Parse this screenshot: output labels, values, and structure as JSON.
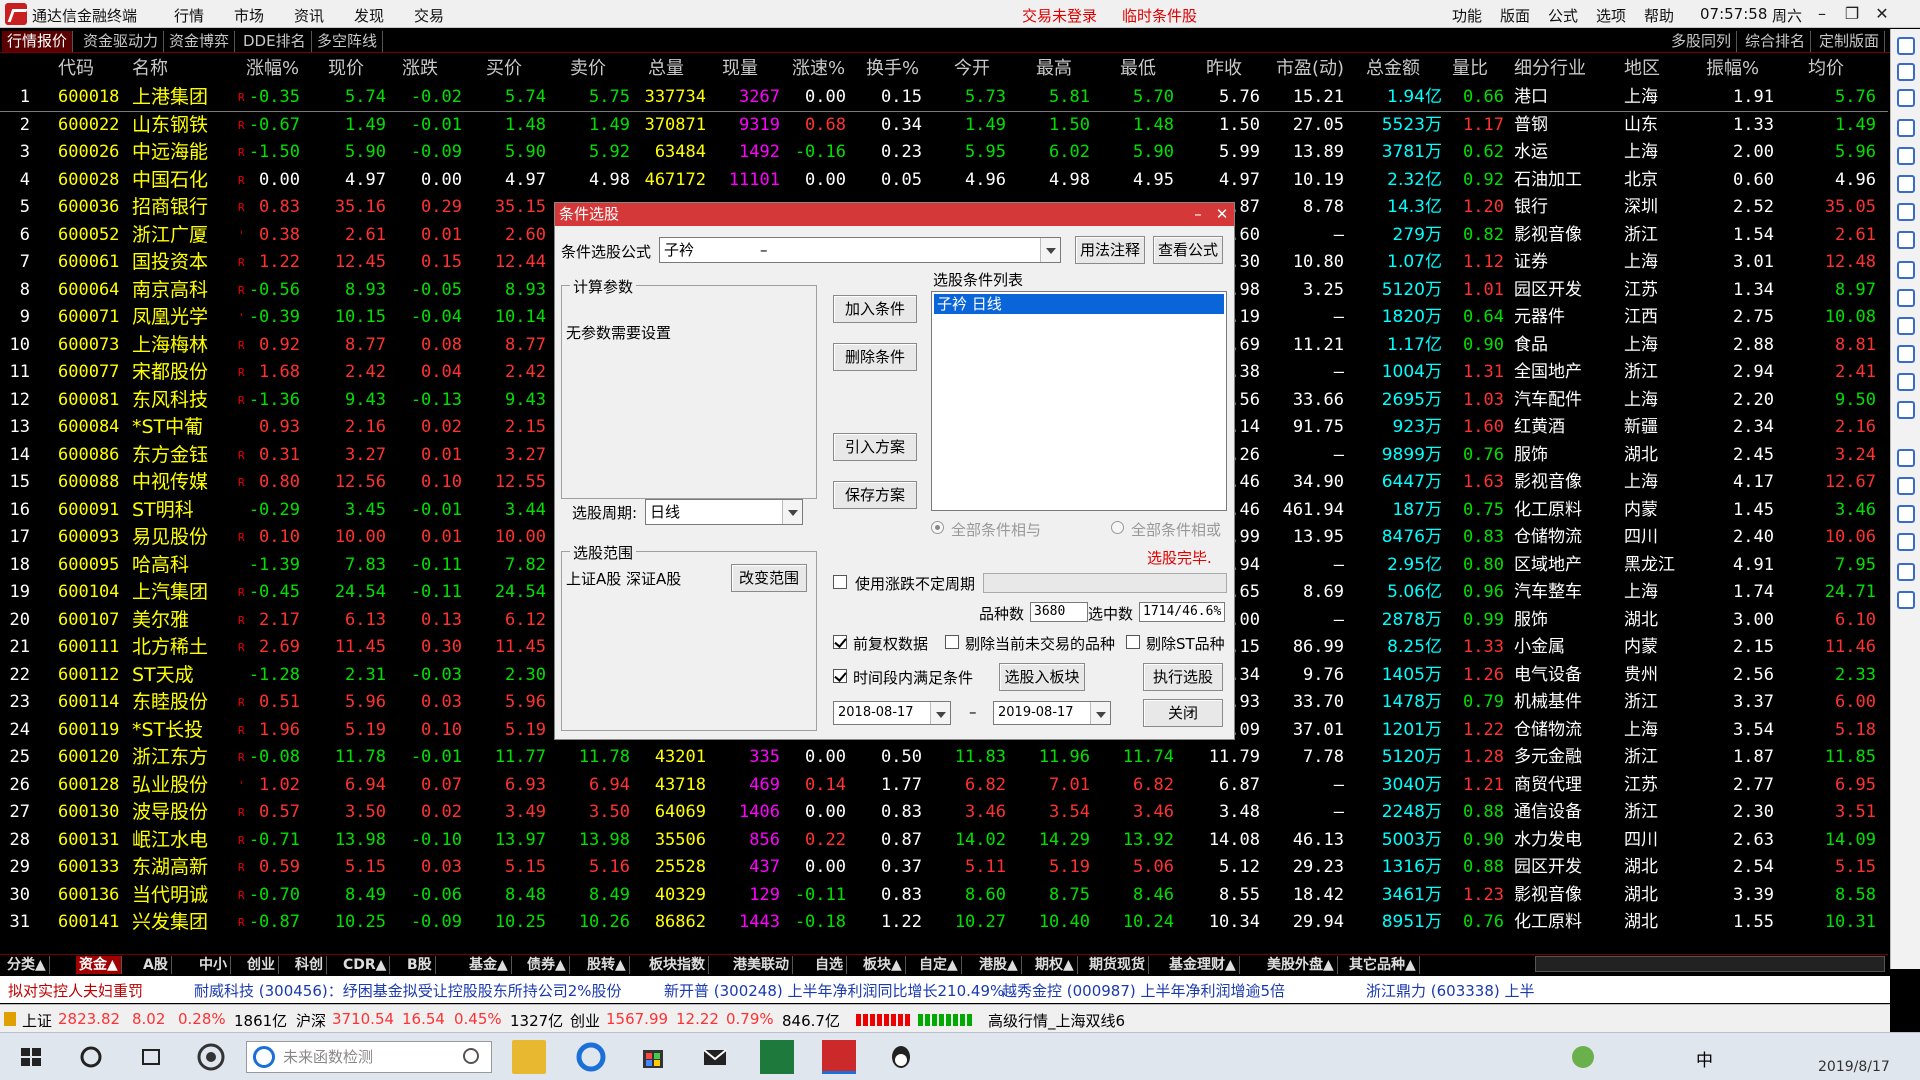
{
  "titlebar": {
    "app_title": "通达信金融终端",
    "menu": [
      "行情",
      "市场",
      "资讯",
      "发现",
      "交易"
    ],
    "status_not_logged": "交易未登录",
    "status_condition": "临时条件股",
    "right_menu": [
      "功能",
      "版面",
      "公式",
      "选项",
      "帮助"
    ],
    "clock": "07:57:58",
    "weekday": "周六"
  },
  "tabs": {
    "left": [
      "行情报价",
      "资金驱动力",
      "资金博弈",
      "DDE排名",
      "多空阵线"
    ],
    "right": [
      "多股同列",
      "综合排名",
      "定制版面"
    ]
  },
  "columns": [
    "代码",
    "名称",
    "涨幅%",
    "现价",
    "涨跌",
    "买价",
    "卖价",
    "总量",
    "现量",
    "涨速%",
    "换手%",
    "今开",
    "最高",
    "最低",
    "昨收",
    "市盈(动)",
    "总金额",
    "量比",
    "细分行业",
    "地区",
    "振幅%",
    "均价"
  ],
  "rows": [
    {
      "idx": "1",
      "code": "600018",
      "name": "上港集团",
      "r": "R",
      "pct": "-0.35",
      "price": "5.74",
      "chg": "-0.02",
      "bid": "5.74",
      "ask": "5.75",
      "vol": "337734",
      "cur": "3267",
      "speed": "0.00",
      "turn": "0.15",
      "open": "5.73",
      "high": "5.81",
      "low": "5.70",
      "prev": "5.76",
      "pe": "15.21",
      "amt": "1.94亿",
      "vr": "0.66",
      "ind": "港口",
      "area": "上海",
      "amp": "1.91",
      "avg": "5.76"
    },
    {
      "idx": "2",
      "code": "600022",
      "name": "山东钢铁",
      "r": "R",
      "pct": "-0.67",
      "price": "1.49",
      "chg": "-0.01",
      "bid": "1.48",
      "ask": "1.49",
      "vol": "370871",
      "cur": "9319",
      "speed": "0.68",
      "turn": "0.34",
      "open": "1.49",
      "high": "1.50",
      "low": "1.48",
      "prev": "1.50",
      "pe": "27.05",
      "amt": "5523万",
      "vr": "1.17",
      "ind": "普钢",
      "area": "山东",
      "amp": "1.33",
      "avg": "1.49"
    },
    {
      "idx": "3",
      "code": "600026",
      "name": "中远海能",
      "r": "R",
      "pct": "-1.50",
      "price": "5.90",
      "chg": "-0.09",
      "bid": "5.90",
      "ask": "5.92",
      "vol": "63484",
      "cur": "1492",
      "speed": "-0.16",
      "turn": "0.23",
      "open": "5.95",
      "high": "6.02",
      "low": "5.90",
      "prev": "5.99",
      "pe": "13.89",
      "amt": "3781万",
      "vr": "0.62",
      "ind": "水运",
      "area": "上海",
      "amp": "2.00",
      "avg": "5.96"
    },
    {
      "idx": "4",
      "code": "600028",
      "name": "中国石化",
      "r": "R",
      "pct": "0.00",
      "price": "4.97",
      "chg": "0.00",
      "bid": "4.97",
      "ask": "4.98",
      "vol": "467172",
      "cur": "11101",
      "speed": "0.00",
      "turn": "0.05",
      "open": "4.96",
      "high": "4.98",
      "low": "4.95",
      "prev": "4.97",
      "pe": "10.19",
      "amt": "2.32亿",
      "vr": "0.92",
      "ind": "石油加工",
      "area": "北京",
      "amp": "0.60",
      "avg": "4.96"
    },
    {
      "idx": "5",
      "code": "600036",
      "name": "招商银行",
      "r": "R",
      "pct": "0.83",
      "price": "35.16",
      "chg": "0.29",
      "bid": "35.15",
      "ask": "",
      "vol": "",
      "cur": "",
      "speed": "",
      "turn": "",
      "open": "",
      "high": "",
      "low": "",
      "prev": ".87",
      "pe": "8.78",
      "amt": "14.3亿",
      "vr": "1.20",
      "ind": "银行",
      "area": "深圳",
      "amp": "2.52",
      "avg": "35.05"
    },
    {
      "idx": "6",
      "code": "600052",
      "name": "浙江广厦",
      "r": "'",
      "pct": "0.38",
      "price": "2.61",
      "chg": "0.01",
      "bid": "2.60",
      "ask": "",
      "vol": "",
      "cur": "",
      "speed": "",
      "turn": "",
      "open": "",
      "high": "",
      "low": "",
      "prev": ".60",
      "pe": "—",
      "amt": "279万",
      "vr": "0.82",
      "ind": "影视音像",
      "area": "浙江",
      "amp": "1.54",
      "avg": "2.61"
    },
    {
      "idx": "7",
      "code": "600061",
      "name": "国投资本",
      "r": "R",
      "pct": "1.22",
      "price": "12.45",
      "chg": "0.15",
      "bid": "12.44",
      "ask": "",
      "vol": "",
      "cur": "",
      "speed": "",
      "turn": "",
      "open": "",
      "high": "",
      "low": "",
      "prev": ".30",
      "pe": "10.80",
      "amt": "1.07亿",
      "vr": "1.12",
      "ind": "证券",
      "area": "上海",
      "amp": "3.01",
      "avg": "12.48"
    },
    {
      "idx": "8",
      "code": "600064",
      "name": "南京高科",
      "r": "R",
      "pct": "-0.56",
      "price": "8.93",
      "chg": "-0.05",
      "bid": "8.93",
      "ask": "",
      "vol": "",
      "cur": "",
      "speed": "",
      "turn": "",
      "open": "",
      "high": "",
      "low": "",
      "prev": ".98",
      "pe": "3.25",
      "amt": "5120万",
      "vr": "1.01",
      "ind": "园区开发",
      "area": "江苏",
      "amp": "1.34",
      "avg": "8.97"
    },
    {
      "idx": "9",
      "code": "600071",
      "name": "凤凰光学",
      "r": "'",
      "pct": "-0.39",
      "price": "10.15",
      "chg": "-0.04",
      "bid": "10.14",
      "ask": "",
      "vol": "",
      "cur": "",
      "speed": "",
      "turn": "",
      "open": "",
      "high": "",
      "low": "",
      "prev": ".19",
      "pe": "—",
      "amt": "1820万",
      "vr": "0.64",
      "ind": "元器件",
      "area": "江西",
      "amp": "2.75",
      "avg": "10.08"
    },
    {
      "idx": "10",
      "code": "600073",
      "name": "上海梅林",
      "r": "R",
      "pct": "0.92",
      "price": "8.77",
      "chg": "0.08",
      "bid": "8.77",
      "ask": "",
      "vol": "",
      "cur": "",
      "speed": "",
      "turn": "",
      "open": "",
      "high": "",
      "low": "",
      "prev": ".69",
      "pe": "11.21",
      "amt": "1.17亿",
      "vr": "0.90",
      "ind": "食品",
      "area": "上海",
      "amp": "2.88",
      "avg": "8.81"
    },
    {
      "idx": "11",
      "code": "600077",
      "name": "宋都股份",
      "r": "R",
      "pct": "1.68",
      "price": "2.42",
      "chg": "0.04",
      "bid": "2.42",
      "ask": "",
      "vol": "",
      "cur": "",
      "speed": "",
      "turn": "",
      "open": "",
      "high": "",
      "low": "",
      "prev": ".38",
      "pe": "—",
      "amt": "1004万",
      "vr": "1.31",
      "ind": "全国地产",
      "area": "浙江",
      "amp": "2.94",
      "avg": "2.41"
    },
    {
      "idx": "12",
      "code": "600081",
      "name": "东风科技",
      "r": "R",
      "pct": "-1.36",
      "price": "9.43",
      "chg": "-0.13",
      "bid": "9.43",
      "ask": "",
      "vol": "",
      "cur": "",
      "speed": "",
      "turn": "",
      "open": "",
      "high": "",
      "low": "",
      "prev": ".56",
      "pe": "33.66",
      "amt": "2695万",
      "vr": "1.03",
      "ind": "汽车配件",
      "area": "上海",
      "amp": "2.20",
      "avg": "9.50"
    },
    {
      "idx": "13",
      "code": "600084",
      "name": "*ST中葡",
      "r": "",
      "pct": "0.93",
      "price": "2.16",
      "chg": "0.02",
      "bid": "2.15",
      "ask": "",
      "vol": "",
      "cur": "",
      "speed": "",
      "turn": "",
      "open": "",
      "high": "",
      "low": "",
      "prev": ".14",
      "pe": "91.75",
      "amt": "923万",
      "vr": "1.60",
      "ind": "红黄酒",
      "area": "新疆",
      "amp": "2.34",
      "avg": "2.16"
    },
    {
      "idx": "14",
      "code": "600086",
      "name": "东方金钰",
      "r": "R",
      "pct": "0.31",
      "price": "3.27",
      "chg": "0.01",
      "bid": "3.27",
      "ask": "",
      "vol": "",
      "cur": "",
      "speed": "",
      "turn": "",
      "open": "",
      "high": "",
      "low": "",
      "prev": ".26",
      "pe": "—",
      "amt": "9899万",
      "vr": "0.76",
      "ind": "服饰",
      "area": "湖北",
      "amp": "2.45",
      "avg": "3.24"
    },
    {
      "idx": "15",
      "code": "600088",
      "name": "中视传媒",
      "r": "R",
      "pct": "0.80",
      "price": "12.56",
      "chg": "0.10",
      "bid": "12.55",
      "ask": "",
      "vol": "",
      "cur": "",
      "speed": "",
      "turn": "",
      "open": "",
      "high": "",
      "low": "",
      "prev": ".46",
      "pe": "34.90",
      "amt": "6447万",
      "vr": "1.63",
      "ind": "影视音像",
      "area": "上海",
      "amp": "4.17",
      "avg": "12.67"
    },
    {
      "idx": "16",
      "code": "600091",
      "name": "ST明科",
      "r": "",
      "pct": "-0.29",
      "price": "3.45",
      "chg": "-0.01",
      "bid": "3.44",
      "ask": "",
      "vol": "",
      "cur": "",
      "speed": "",
      "turn": "",
      "open": "",
      "high": "",
      "low": "",
      "prev": ".46",
      "pe": "461.94",
      "amt": "187万",
      "vr": "0.75",
      "ind": "化工原料",
      "area": "内蒙",
      "amp": "1.45",
      "avg": "3.46"
    },
    {
      "idx": "17",
      "code": "600093",
      "name": "易见股份",
      "r": "R",
      "pct": "0.10",
      "price": "10.00",
      "chg": "0.01",
      "bid": "10.00",
      "ask": "",
      "vol": "",
      "cur": "",
      "speed": "",
      "turn": "",
      "open": "",
      "high": "",
      "low": "",
      "prev": ".99",
      "pe": "13.95",
      "amt": "8476万",
      "vr": "0.83",
      "ind": "仓储物流",
      "area": "四川",
      "amp": "2.40",
      "avg": "10.06"
    },
    {
      "idx": "18",
      "code": "600095",
      "name": "哈高科",
      "r": "",
      "pct": "-1.39",
      "price": "7.83",
      "chg": "-0.11",
      "bid": "7.82",
      "ask": "",
      "vol": "",
      "cur": "",
      "speed": "",
      "turn": "",
      "open": "",
      "high": "",
      "low": "",
      "prev": ".94",
      "pe": "—",
      "amt": "2.95亿",
      "vr": "0.80",
      "ind": "区域地产",
      "area": "黑龙江",
      "amp": "4.91",
      "avg": "7.95"
    },
    {
      "idx": "19",
      "code": "600104",
      "name": "上汽集团",
      "r": "R",
      "pct": "-0.45",
      "price": "24.54",
      "chg": "-0.11",
      "bid": "24.54",
      "ask": "",
      "vol": "",
      "cur": "",
      "speed": "",
      "turn": "",
      "open": "",
      "high": "",
      "low": "",
      "prev": ".65",
      "pe": "8.69",
      "amt": "5.06亿",
      "vr": "0.96",
      "ind": "汽车整车",
      "area": "上海",
      "amp": "1.74",
      "avg": "24.71"
    },
    {
      "idx": "20",
      "code": "600107",
      "name": "美尔雅",
      "r": "R",
      "pct": "2.17",
      "price": "6.13",
      "chg": "0.13",
      "bid": "6.12",
      "ask": "",
      "vol": "",
      "cur": "",
      "speed": "",
      "turn": "",
      "open": "",
      "high": "",
      "low": "",
      "prev": ".00",
      "pe": "—",
      "amt": "2878万",
      "vr": "0.99",
      "ind": "服饰",
      "area": "湖北",
      "amp": "3.00",
      "avg": "6.10"
    },
    {
      "idx": "21",
      "code": "600111",
      "name": "北方稀土",
      "r": "R",
      "pct": "2.69",
      "price": "11.45",
      "chg": "0.30",
      "bid": "11.45",
      "ask": "",
      "vol": "",
      "cur": "",
      "speed": "",
      "turn": "",
      "open": "",
      "high": "",
      "low": "",
      "prev": ".15",
      "pe": "86.99",
      "amt": "8.25亿",
      "vr": "1.33",
      "ind": "小金属",
      "area": "内蒙",
      "amp": "2.15",
      "avg": "11.46"
    },
    {
      "idx": "22",
      "code": "600112",
      "name": "ST天成",
      "r": "",
      "pct": "-1.28",
      "price": "2.31",
      "chg": "-0.03",
      "bid": "2.30",
      "ask": "",
      "vol": "",
      "cur": "",
      "speed": "",
      "turn": "",
      "open": "",
      "high": "",
      "low": "",
      "prev": ".34",
      "pe": "9.76",
      "amt": "1405万",
      "vr": "1.26",
      "ind": "电气设备",
      "area": "贵州",
      "amp": "2.56",
      "avg": "2.33"
    },
    {
      "idx": "23",
      "code": "600114",
      "name": "东睦股份",
      "r": "R",
      "pct": "0.51",
      "price": "5.96",
      "chg": "0.03",
      "bid": "5.96",
      "ask": "",
      "vol": "",
      "cur": "",
      "speed": "",
      "turn": "",
      "open": "",
      "high": "",
      "low": "",
      "prev": ".93",
      "pe": "33.70",
      "amt": "1478万",
      "vr": "0.79",
      "ind": "机械基件",
      "area": "浙江",
      "amp": "3.37",
      "avg": "6.00"
    },
    {
      "idx": "24",
      "code": "600119",
      "name": "*ST长投",
      "r": "R",
      "pct": "1.96",
      "price": "5.19",
      "chg": "0.10",
      "bid": "5.19",
      "ask": "",
      "vol": "",
      "cur": "",
      "speed": "",
      "turn": "",
      "open": "",
      "high": "",
      "low": "",
      "prev": ".09",
      "pe": "37.01",
      "amt": "1201万",
      "vr": "1.22",
      "ind": "仓储物流",
      "area": "上海",
      "amp": "3.54",
      "avg": "5.18"
    },
    {
      "idx": "25",
      "code": "600120",
      "name": "浙江东方",
      "r": "R",
      "pct": "-0.08",
      "price": "11.78",
      "chg": "-0.01",
      "bid": "11.77",
      "ask": "11.78",
      "vol": "43201",
      "cur": "335",
      "speed": "0.00",
      "turn": "0.50",
      "open": "11.83",
      "high": "11.96",
      "low": "11.74",
      "prev": "11.79",
      "pe": "7.78",
      "amt": "5120万",
      "vr": "1.28",
      "ind": "多元金融",
      "area": "浙江",
      "amp": "1.87",
      "avg": "11.85"
    },
    {
      "idx": "26",
      "code": "600128",
      "name": "弘业股份",
      "r": "'",
      "pct": "1.02",
      "price": "6.94",
      "chg": "0.07",
      "bid": "6.93",
      "ask": "6.94",
      "vol": "43718",
      "cur": "469",
      "speed": "0.14",
      "turn": "1.77",
      "open": "6.82",
      "high": "7.01",
      "low": "6.82",
      "prev": "6.87",
      "pe": "—",
      "amt": "3040万",
      "vr": "1.21",
      "ind": "商贸代理",
      "area": "江苏",
      "amp": "2.77",
      "avg": "6.95"
    },
    {
      "idx": "27",
      "code": "600130",
      "name": "波导股份",
      "r": "R",
      "pct": "0.57",
      "price": "3.50",
      "chg": "0.02",
      "bid": "3.49",
      "ask": "3.50",
      "vol": "64069",
      "cur": "1406",
      "speed": "0.00",
      "turn": "0.83",
      "open": "3.46",
      "high": "3.54",
      "low": "3.46",
      "prev": "3.48",
      "pe": "—",
      "amt": "2248万",
      "vr": "0.88",
      "ind": "通信设备",
      "area": "浙江",
      "amp": "2.30",
      "avg": "3.51"
    },
    {
      "idx": "28",
      "code": "600131",
      "name": "岷江水电",
      "r": "R",
      "pct": "-0.71",
      "price": "13.98",
      "chg": "-0.10",
      "bid": "13.97",
      "ask": "13.98",
      "vol": "35506",
      "cur": "856",
      "speed": "0.22",
      "turn": "0.87",
      "open": "14.02",
      "high": "14.29",
      "low": "13.92",
      "prev": "14.08",
      "pe": "46.13",
      "amt": "5003万",
      "vr": "0.90",
      "ind": "水力发电",
      "area": "四川",
      "amp": "2.63",
      "avg": "14.09"
    },
    {
      "idx": "29",
      "code": "600133",
      "name": "东湖高新",
      "r": "R",
      "pct": "0.59",
      "price": "5.15",
      "chg": "0.03",
      "bid": "5.15",
      "ask": "5.16",
      "vol": "25528",
      "cur": "437",
      "speed": "0.00",
      "turn": "0.37",
      "open": "5.11",
      "high": "5.19",
      "low": "5.06",
      "prev": "5.12",
      "pe": "29.23",
      "amt": "1316万",
      "vr": "0.88",
      "ind": "园区开发",
      "area": "湖北",
      "amp": "2.54",
      "avg": "5.15"
    },
    {
      "idx": "30",
      "code": "600136",
      "name": "当代明诚",
      "r": "R",
      "pct": "-0.70",
      "price": "8.49",
      "chg": "-0.06",
      "bid": "8.48",
      "ask": "8.49",
      "vol": "40329",
      "cur": "129",
      "speed": "-0.11",
      "turn": "0.83",
      "open": "8.60",
      "high": "8.75",
      "low": "8.46",
      "prev": "8.55",
      "pe": "18.42",
      "amt": "3461万",
      "vr": "1.23",
      "ind": "影视音像",
      "area": "湖北",
      "amp": "3.39",
      "avg": "8.58"
    },
    {
      "idx": "31",
      "code": "600141",
      "name": "兴发集团",
      "r": "R",
      "pct": "-0.87",
      "price": "10.25",
      "chg": "-0.09",
      "bid": "10.25",
      "ask": "10.26",
      "vol": "86862",
      "cur": "1443",
      "speed": "-0.18",
      "turn": "1.22",
      "open": "10.27",
      "high": "10.40",
      "low": "10.24",
      "prev": "10.34",
      "pe": "29.94",
      "amt": "8951万",
      "vr": "0.76",
      "ind": "化工原料",
      "area": "湖北",
      "amp": "1.55",
      "avg": "10.31"
    }
  ],
  "bottom_tabs": [
    "分类▲",
    "资金▲",
    "A股",
    "中小",
    "创业",
    "科创",
    "CDR▲",
    "B股",
    "基金▲",
    "债券▲",
    "股转▲",
    "板块指数",
    "港美联动",
    "自选",
    "板块▲",
    "自定▲",
    "港股▲",
    "期权▲",
    "期货现货",
    "基金理财▲",
    "美股外盘▲",
    "其它品种▲"
  ],
  "news": [
    {
      "text": "拟对实控人夫妇重罚",
      "red": true
    },
    {
      "text": "耐威科技 (300456)：纾困基金拟受让控股股东所持公司2%股份",
      "red": false
    },
    {
      "text": "新开普 (300248) 上半年净利润同比增长210.49%",
      "red": false
    },
    {
      "text": "越秀金控 (000987) 上半年净利润增逾5倍",
      "red": false
    },
    {
      "text": "浙江鼎力 (603338) 上半",
      "red": false
    }
  ],
  "indexbar": {
    "sh_name": "上证",
    "sh_val": "2823.82",
    "sh_chg": "8.02",
    "sh_pct": "0.28%",
    "sh_amt": "1861亿",
    "hs_name": "沪深",
    "hs_val": "3710.54",
    "hs_chg": "16.54",
    "hs_pct": "0.45%",
    "hs_amt": "1327亿",
    "cy_name": "创业",
    "cy_val": "1567.99",
    "cy_chg": "12.22",
    "cy_pct": "0.79%",
    "cy_amt": "846.7亿",
    "status": "高级行情_上海双线6"
  },
  "taskbar": {
    "search_placeholder": "未来函数检测",
    "ime": "中",
    "date": "2019/8/17"
  },
  "dialog": {
    "title": "条件选股",
    "formula_label": "条件选股公式",
    "formula_value": "子衿",
    "formula_dash": "–",
    "btn_usage": "用法注释",
    "btn_view": "查看公式",
    "calc_group": "计算参数",
    "no_params": "无参数需要设置",
    "btn_add": "加入条件",
    "btn_delete": "删除条件",
    "btn_import": "引入方案",
    "btn_save": "保存方案",
    "list_title": "选股条件列表",
    "list_item": "子衿   日线",
    "period_label": "选股周期:",
    "period_value": "日线",
    "radio_and": "全部条件相与",
    "radio_or": "全部条件相或",
    "done": "选股完毕.",
    "range_group": "选股范围",
    "range_value": "上证A股  深证A股",
    "btn_change": "改变范围",
    "use_indef": "使用涨跌不定周期",
    "count_label": "品种数",
    "count_value": "3680",
    "selected_label": "选中数",
    "selected_value": "1714/46.6%",
    "chk_fq": "前复权数据",
    "chk_exclude_untraded": "剔除当前未交易的品种",
    "chk_exclude_st": "剔除ST品种",
    "chk_period": "时间段内满足条件",
    "btn_to_block": "选股入板块",
    "btn_exec": "执行选股",
    "date_from": "2018-08-17",
    "date_to": "2019-08-17",
    "date_sep": "–",
    "btn_close": "关闭"
  }
}
